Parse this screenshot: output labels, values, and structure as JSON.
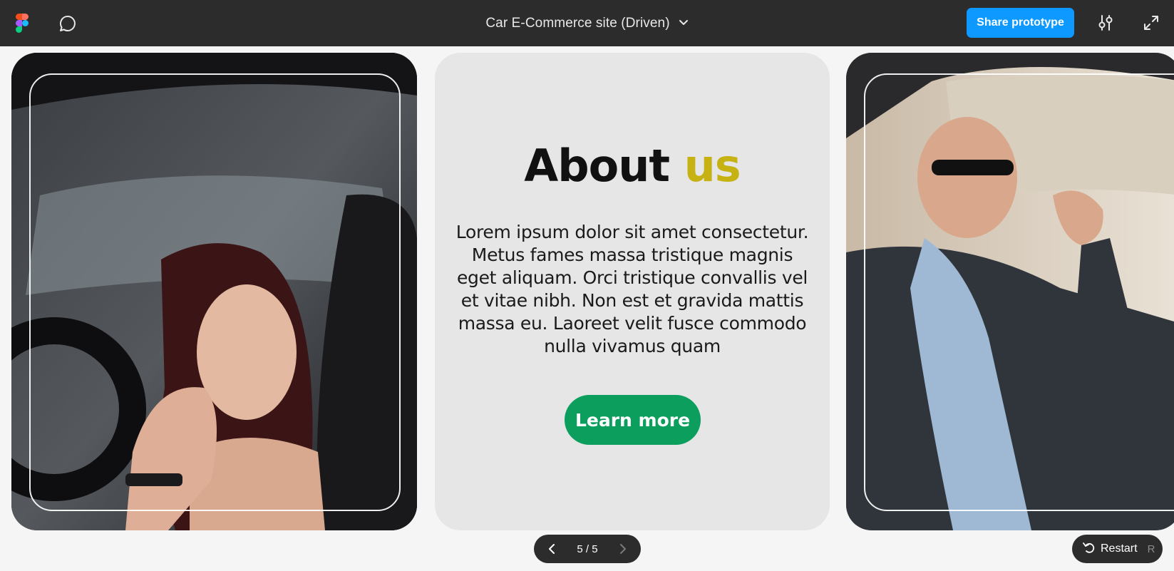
{
  "toolbar": {
    "title": "Car E-Commerce site (Driven)",
    "share_label": "Share prototype",
    "icons": [
      "figma-logo-icon",
      "comment-icon",
      "chevron-down-icon",
      "settings-sliders-icon",
      "expand-icon"
    ],
    "share_color": "#0d99ff"
  },
  "slides": {
    "left_photo": "woman-in-car-photo",
    "right_photo": "man-in-car-photo",
    "center": {
      "title_main": "About",
      "title_accent": "us",
      "body": "Lorem ipsum dolor sit amet consectetur. Metus fames massa tristique magnis eget aliquam. Orci tristique convallis vel et vitae nibh. Non est et gravida mattis massa eu. Laoreet velit fusce commodo nulla vivamus quam",
      "button_label": "Learn more",
      "accent_color": "#c7b213",
      "button_color": "#0b9e5c"
    }
  },
  "pager": {
    "text": "5 / 5"
  },
  "restart": {
    "label": "Restart",
    "shortcut": "R"
  }
}
